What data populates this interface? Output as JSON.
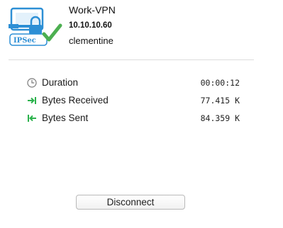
{
  "connection": {
    "name": "Work-VPN",
    "ip": "10.10.10.60",
    "user": "clementine",
    "icon_label": "IPSec",
    "icon": "ipsec-vpn-lock-icon"
  },
  "stats": [
    {
      "label": "Duration",
      "value": "00:00:12",
      "icon": "clock-icon",
      "color": "#7a7a7a"
    },
    {
      "label": "Bytes Received",
      "value": "77.415 K",
      "icon": "arrow-received-icon",
      "color": "#2bb24c"
    },
    {
      "label": "Bytes Sent",
      "value": "84.359 K",
      "icon": "arrow-sent-icon",
      "color": "#2bb24c"
    }
  ],
  "actions": {
    "disconnect_label": "Disconnect"
  },
  "colors": {
    "accent": "#2d8fd5",
    "success": "#4caf50"
  }
}
